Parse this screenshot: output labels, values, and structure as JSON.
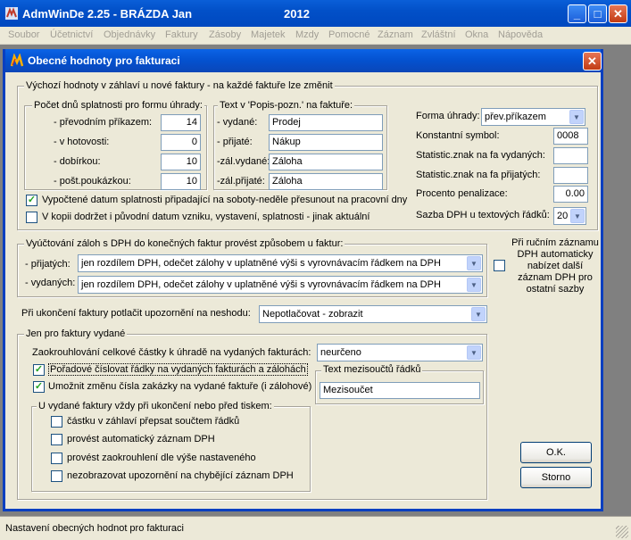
{
  "app": {
    "title": "AdmWinDe 2.25 - BRÁZDA Jan",
    "year": "2012",
    "min": "_",
    "max": "□",
    "close": "✕"
  },
  "menu": [
    "Soubor",
    "Účetnictví",
    "Objednávky",
    "Faktury",
    "Zásoby",
    "Majetek",
    "Mzdy",
    "Pomocné",
    "Záznam",
    "Zvláštní",
    "Okna",
    "Nápověda"
  ],
  "dialog": {
    "title": "Obecné hodnoty pro fakturaci",
    "close": "✕"
  },
  "header_group": {
    "label": "Výchozí hodnoty v záhlaví u nové faktury - na každé faktuře lze změnit"
  },
  "due_days": {
    "label": "Počet dnů splatnosti pro formu úhrady:",
    "rows": [
      {
        "label": "- převodním příkazem:",
        "value": "14"
      },
      {
        "label": "- v hotovosti:",
        "value": "0"
      },
      {
        "label": "- dobírkou:",
        "value": "10"
      },
      {
        "label": "- pošt.poukázkou:",
        "value": "10"
      }
    ]
  },
  "popis": {
    "label": "Text v 'Popis-pozn.' na faktuře:",
    "rows": [
      {
        "label": "- vydané:",
        "value": "Prodej"
      },
      {
        "label": "- přijaté:",
        "value": "Nákup"
      },
      {
        "label": "-zál.vydané:",
        "value": "Záloha"
      },
      {
        "label": "-zál.přijaté:",
        "value": "Záloha"
      }
    ]
  },
  "right_fields": {
    "payment_label": "Forma úhrady:",
    "payment_value": "přev.příkazem",
    "const_label": "Konstantní symbol:",
    "const_value": "0008",
    "stat_issued_label": "Statistic.znak na fa vydaných:",
    "stat_issued_value": "",
    "stat_received_label": "Statistic.znak na fa přijatých:",
    "stat_received_value": "",
    "penalty_label": "Procento penalizace:",
    "penalty_value": "0.00",
    "vat_label": "Sazba DPH u textových řádků:",
    "vat_value": "20"
  },
  "checks_top": [
    {
      "label": "Vypočtené datum splatnosti připadající na soboty-neděle přesunout na pracovní dny",
      "checked": true
    },
    {
      "label": "V kopii dodržet i původní datum vzniku, vystavení, splatnosti - jinak aktuální",
      "checked": false
    }
  ],
  "deposit_group": {
    "label": "Vyúčtování záloh s DPH do konečných faktur provést způsobem u faktur:",
    "received_label": "- přijatých:",
    "received_value": "jen rozdílem DPH, odečet zálohy v uplatněné výši s vyrovnávacím řádkem na DPH",
    "issued_label": "- vydaných:",
    "issued_value": "jen rozdílem DPH, odečet zálohy v uplatněné výši s vyrovnávacím řádkem na DPH"
  },
  "manual_entry": {
    "label": "Při ručním záznamu DPH automaticky nabízet další záznam DPH pro ostatní sazby",
    "checked": false
  },
  "mismatch": {
    "label": "Při ukončení faktury potlačit upozornění na neshodu:",
    "value": "Nepotlačovat - zobrazit"
  },
  "issued_group": {
    "label": "Jen pro faktury vydané",
    "rounding_label": "Zaokrouhlování celkové částky k úhradě na vydaných fakturách:",
    "rounding_value": "neurčeno",
    "checks": [
      {
        "label": "Pořadové číslovat řádky na vydaných fakturách a zálohách",
        "checked": true
      },
      {
        "label": "Umožnit změnu čísla zakázky na vydané faktuře (i zálohové)",
        "checked": true
      }
    ],
    "subtotal_label": "Text mezisoučtů řádků",
    "subtotal_value": "Mezisoučet",
    "print_group_label": "U vydané faktury vždy při ukončení nebo před tiskem:",
    "print_checks": [
      {
        "label": "částku v záhlaví přepsat součtem řádků",
        "checked": false
      },
      {
        "label": "provést automatický záznam DPH",
        "checked": false
      },
      {
        "label": "provést zaokrouhlení dle výše nastaveného",
        "checked": false
      },
      {
        "label": "nezobrazovat upozornění na chybějící záznam DPH",
        "checked": false
      }
    ]
  },
  "buttons": {
    "ok": "O.K.",
    "cancel": "Storno"
  },
  "status": "Nastavení obecných hodnot pro fakturaci",
  "colors": {
    "titlebar": "#0A5FD8",
    "dialog_bg": "#ECE9D8",
    "check": "#21A121"
  }
}
